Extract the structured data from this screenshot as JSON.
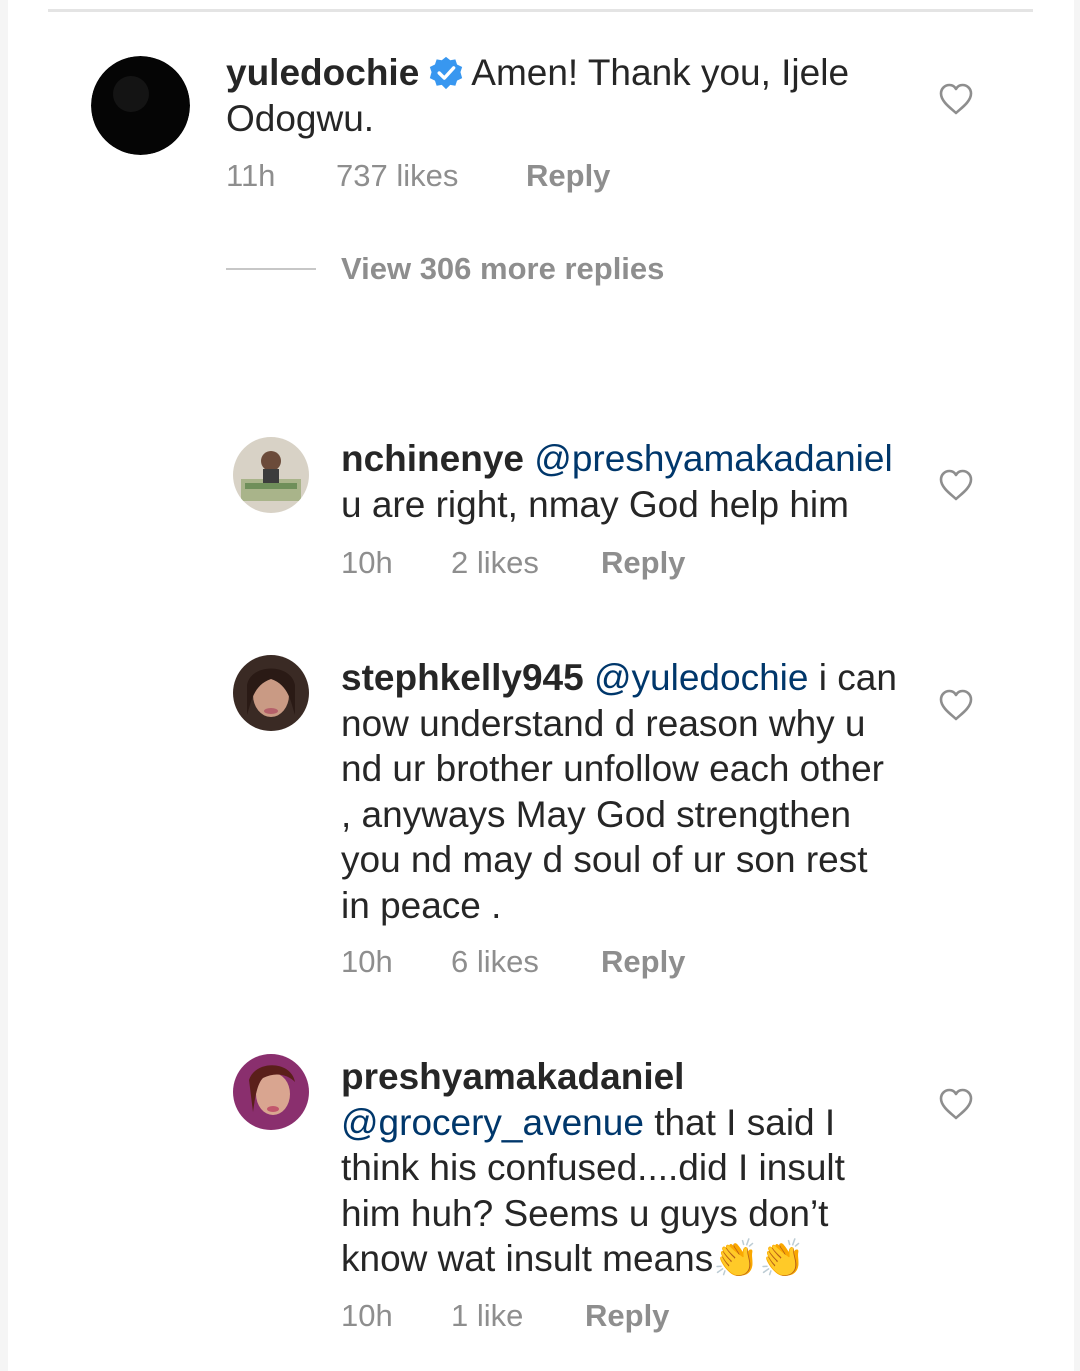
{
  "comments": [
    {
      "username": "yuledochie",
      "verified": true,
      "mention": "",
      "text": "Amen! Thank you, Ijele Odogwu.",
      "time": "11h",
      "likes": "737 likes",
      "reply": "Reply",
      "avatar_icon": "avatar-dark-icon"
    },
    {
      "username": "nchinenye",
      "mention": "@preshyamakadaniel",
      "text": "u are right, nmay God help him",
      "time": "10h",
      "likes": "2 likes",
      "reply": "Reply",
      "avatar_icon": "avatar-photo-icon"
    },
    {
      "username": "stephkelly945",
      "mention": "@yuledochie",
      "text": "i can now understand d reason why u nd ur brother unfollow each other , anyways May God strengthen you nd may d soul of ur son rest in peace .",
      "time": "10h",
      "likes": "6 likes",
      "reply": "Reply",
      "avatar_icon": "avatar-photo-icon"
    },
    {
      "username": "preshyamakadaniel",
      "mention": "@grocery_avenue",
      "text": "that I said I think his confused....did I insult him huh? Seems u guys don’t know wat insult means",
      "emoji": "👏👏",
      "time": "10h",
      "likes": "1 like",
      "reply": "Reply",
      "avatar_icon": "avatar-photo-icon"
    }
  ],
  "view_replies": {
    "label": "View 306 more replies"
  },
  "colors": {
    "text": "#262626",
    "mention": "#00376b",
    "meta": "#8e8e8e",
    "verified": "#3897f0",
    "background": "#ffffff"
  },
  "icons": {
    "like": "heart-outline-icon",
    "verified": "verified-badge-icon",
    "emoji": "clapping-hands-emoji"
  }
}
